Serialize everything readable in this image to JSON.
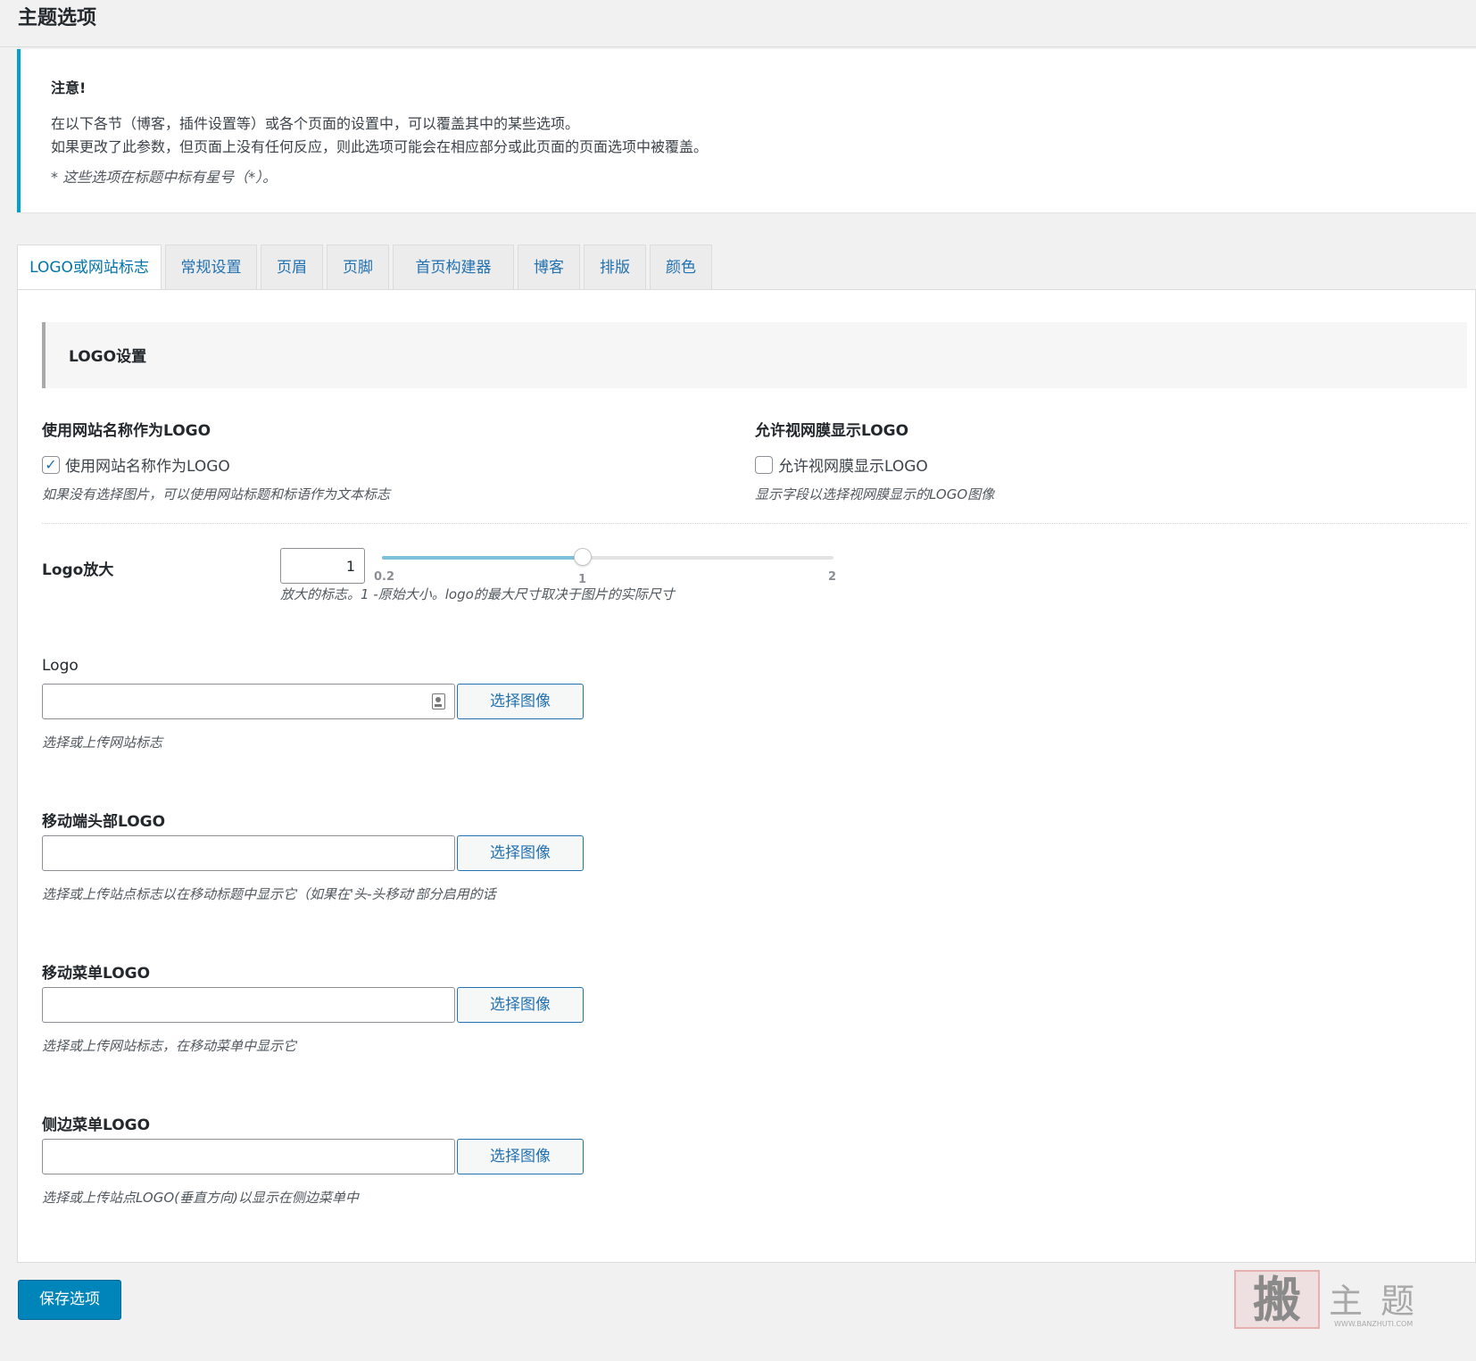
{
  "page": {
    "title": "主题选项"
  },
  "notice": {
    "title": "注意!",
    "line1": "在以下各节（博客，插件设置等）或各个页面的设置中，可以覆盖其中的某些选项。",
    "line2": "如果更改了此参数，但页面上没有任何反应，则此选项可能会在相应部分或此页面的页面选项中被覆盖。",
    "note": "* 这些选项在标题中标有星号（*）。"
  },
  "tabs": [
    {
      "label": "LOGO或网站标志",
      "active": true
    },
    {
      "label": "常规设置"
    },
    {
      "label": "页眉"
    },
    {
      "label": "页脚"
    },
    {
      "label": "首页构建器"
    },
    {
      "label": "博客"
    },
    {
      "label": "排版"
    },
    {
      "label": "颜色"
    }
  ],
  "section": {
    "title": "LOGO设置"
  },
  "use_site_name": {
    "label": "使用网站名称作为LOGO",
    "checkbox_label": "使用网站名称作为LOGO",
    "checked": true,
    "check_mark": "✓",
    "description": "如果没有选择图片，可以使用网站标题和标语作为文本标志"
  },
  "retina": {
    "label": "允许视网膜显示LOGO",
    "checkbox_label": "允许视网膜显示LOGO",
    "checked": false,
    "description": "显示字段以选择视网膜显示的LOGO图像"
  },
  "logo_zoom": {
    "label": "Logo放大",
    "value": "1",
    "min_label": "0.2",
    "mid_label": "1",
    "max_label": "2",
    "min": 0.2,
    "max": 2,
    "current": 1,
    "description": "放大的标志。1 -原始大小。logo的最大尺寸取决于图片的实际尺寸"
  },
  "logo": {
    "label": "Logo",
    "button": "选择图像",
    "description": "选择或上传网站标志",
    "icon": "image-icon"
  },
  "mobile_header_logo": {
    "label": "移动端头部LOGO",
    "button": "选择图像",
    "description": "选择或上传站点标志以在移动标题中显示它（如果在'头-头移动'部分启用的话"
  },
  "mobile_menu_logo": {
    "label": "移动菜单LOGO",
    "button": "选择图像",
    "description": "选择或上传网站标志，在移动菜单中显示它"
  },
  "side_menu_logo": {
    "label": "侧边菜单LOGO",
    "button": "选择图像",
    "description": "选择或上传站点LOGO(垂直方向)以显示在侧边菜单中"
  },
  "footer": {
    "save_label": "保存选项"
  },
  "watermark": {
    "stamp": "搬",
    "text": "主题",
    "url": "WWW.BANZHUTI.COM"
  },
  "colors": {
    "accent": "#00a0d2",
    "link": "#2271b1",
    "primary_button": "#0085ba",
    "slider_fill": "#7ec1d9"
  }
}
